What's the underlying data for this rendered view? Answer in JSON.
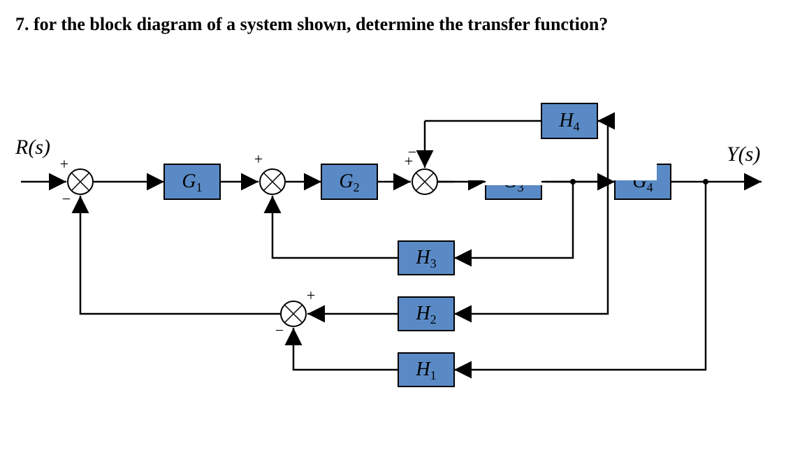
{
  "question": "7.  for the block diagram of a system shown, determine the transfer function?",
  "labels": {
    "input": "R(s)",
    "output": "Y(s)"
  },
  "blocks": {
    "g1": {
      "base": "G",
      "sub": "1"
    },
    "g2": {
      "base": "G",
      "sub": "2"
    },
    "g3": {
      "base": "G",
      "sub": "3"
    },
    "g4": {
      "base": "G",
      "sub": "4"
    },
    "h1": {
      "base": "H",
      "sub": "1"
    },
    "h2": {
      "base": "H",
      "sub": "2"
    },
    "h3": {
      "base": "H",
      "sub": "3"
    },
    "h4": {
      "base": "H",
      "sub": "4"
    }
  },
  "summing_junctions": [
    {
      "id": 1,
      "inputs": [
        {
          "from": "R(s)",
          "sign": "+"
        },
        {
          "from": "sum4",
          "sign": "-"
        }
      ]
    },
    {
      "id": 2,
      "inputs": [
        {
          "from": "G1",
          "sign": "+"
        },
        {
          "from": "H3",
          "sign": "+"
        }
      ]
    },
    {
      "id": 3,
      "inputs": [
        {
          "from": "G2",
          "sign": "+"
        },
        {
          "from": "H4",
          "sign": "-"
        }
      ]
    },
    {
      "id": 4,
      "inputs": [
        {
          "from": "H2",
          "sign": "+"
        },
        {
          "from": "H1",
          "sign": "-"
        }
      ]
    }
  ],
  "topology": {
    "forward_path": [
      "R(s)",
      "sum1",
      "G1",
      "sum2",
      "G2",
      "sum3",
      "G3",
      "G4",
      "Y(s)"
    ],
    "feedback_loops": [
      {
        "block": "H4",
        "from_after": "G3",
        "to": "sum3",
        "sign": "-"
      },
      {
        "block": "H3",
        "from_after": "G3",
        "to": "sum2",
        "sign": "+"
      },
      {
        "block": "H2",
        "from_after": "G3",
        "to": "sum4",
        "sign": "+"
      },
      {
        "block": "H1",
        "from_after": "G4",
        "to": "sum4",
        "sign": "-"
      },
      {
        "block": null,
        "from": "sum4",
        "to": "sum1",
        "sign": "-"
      }
    ]
  }
}
